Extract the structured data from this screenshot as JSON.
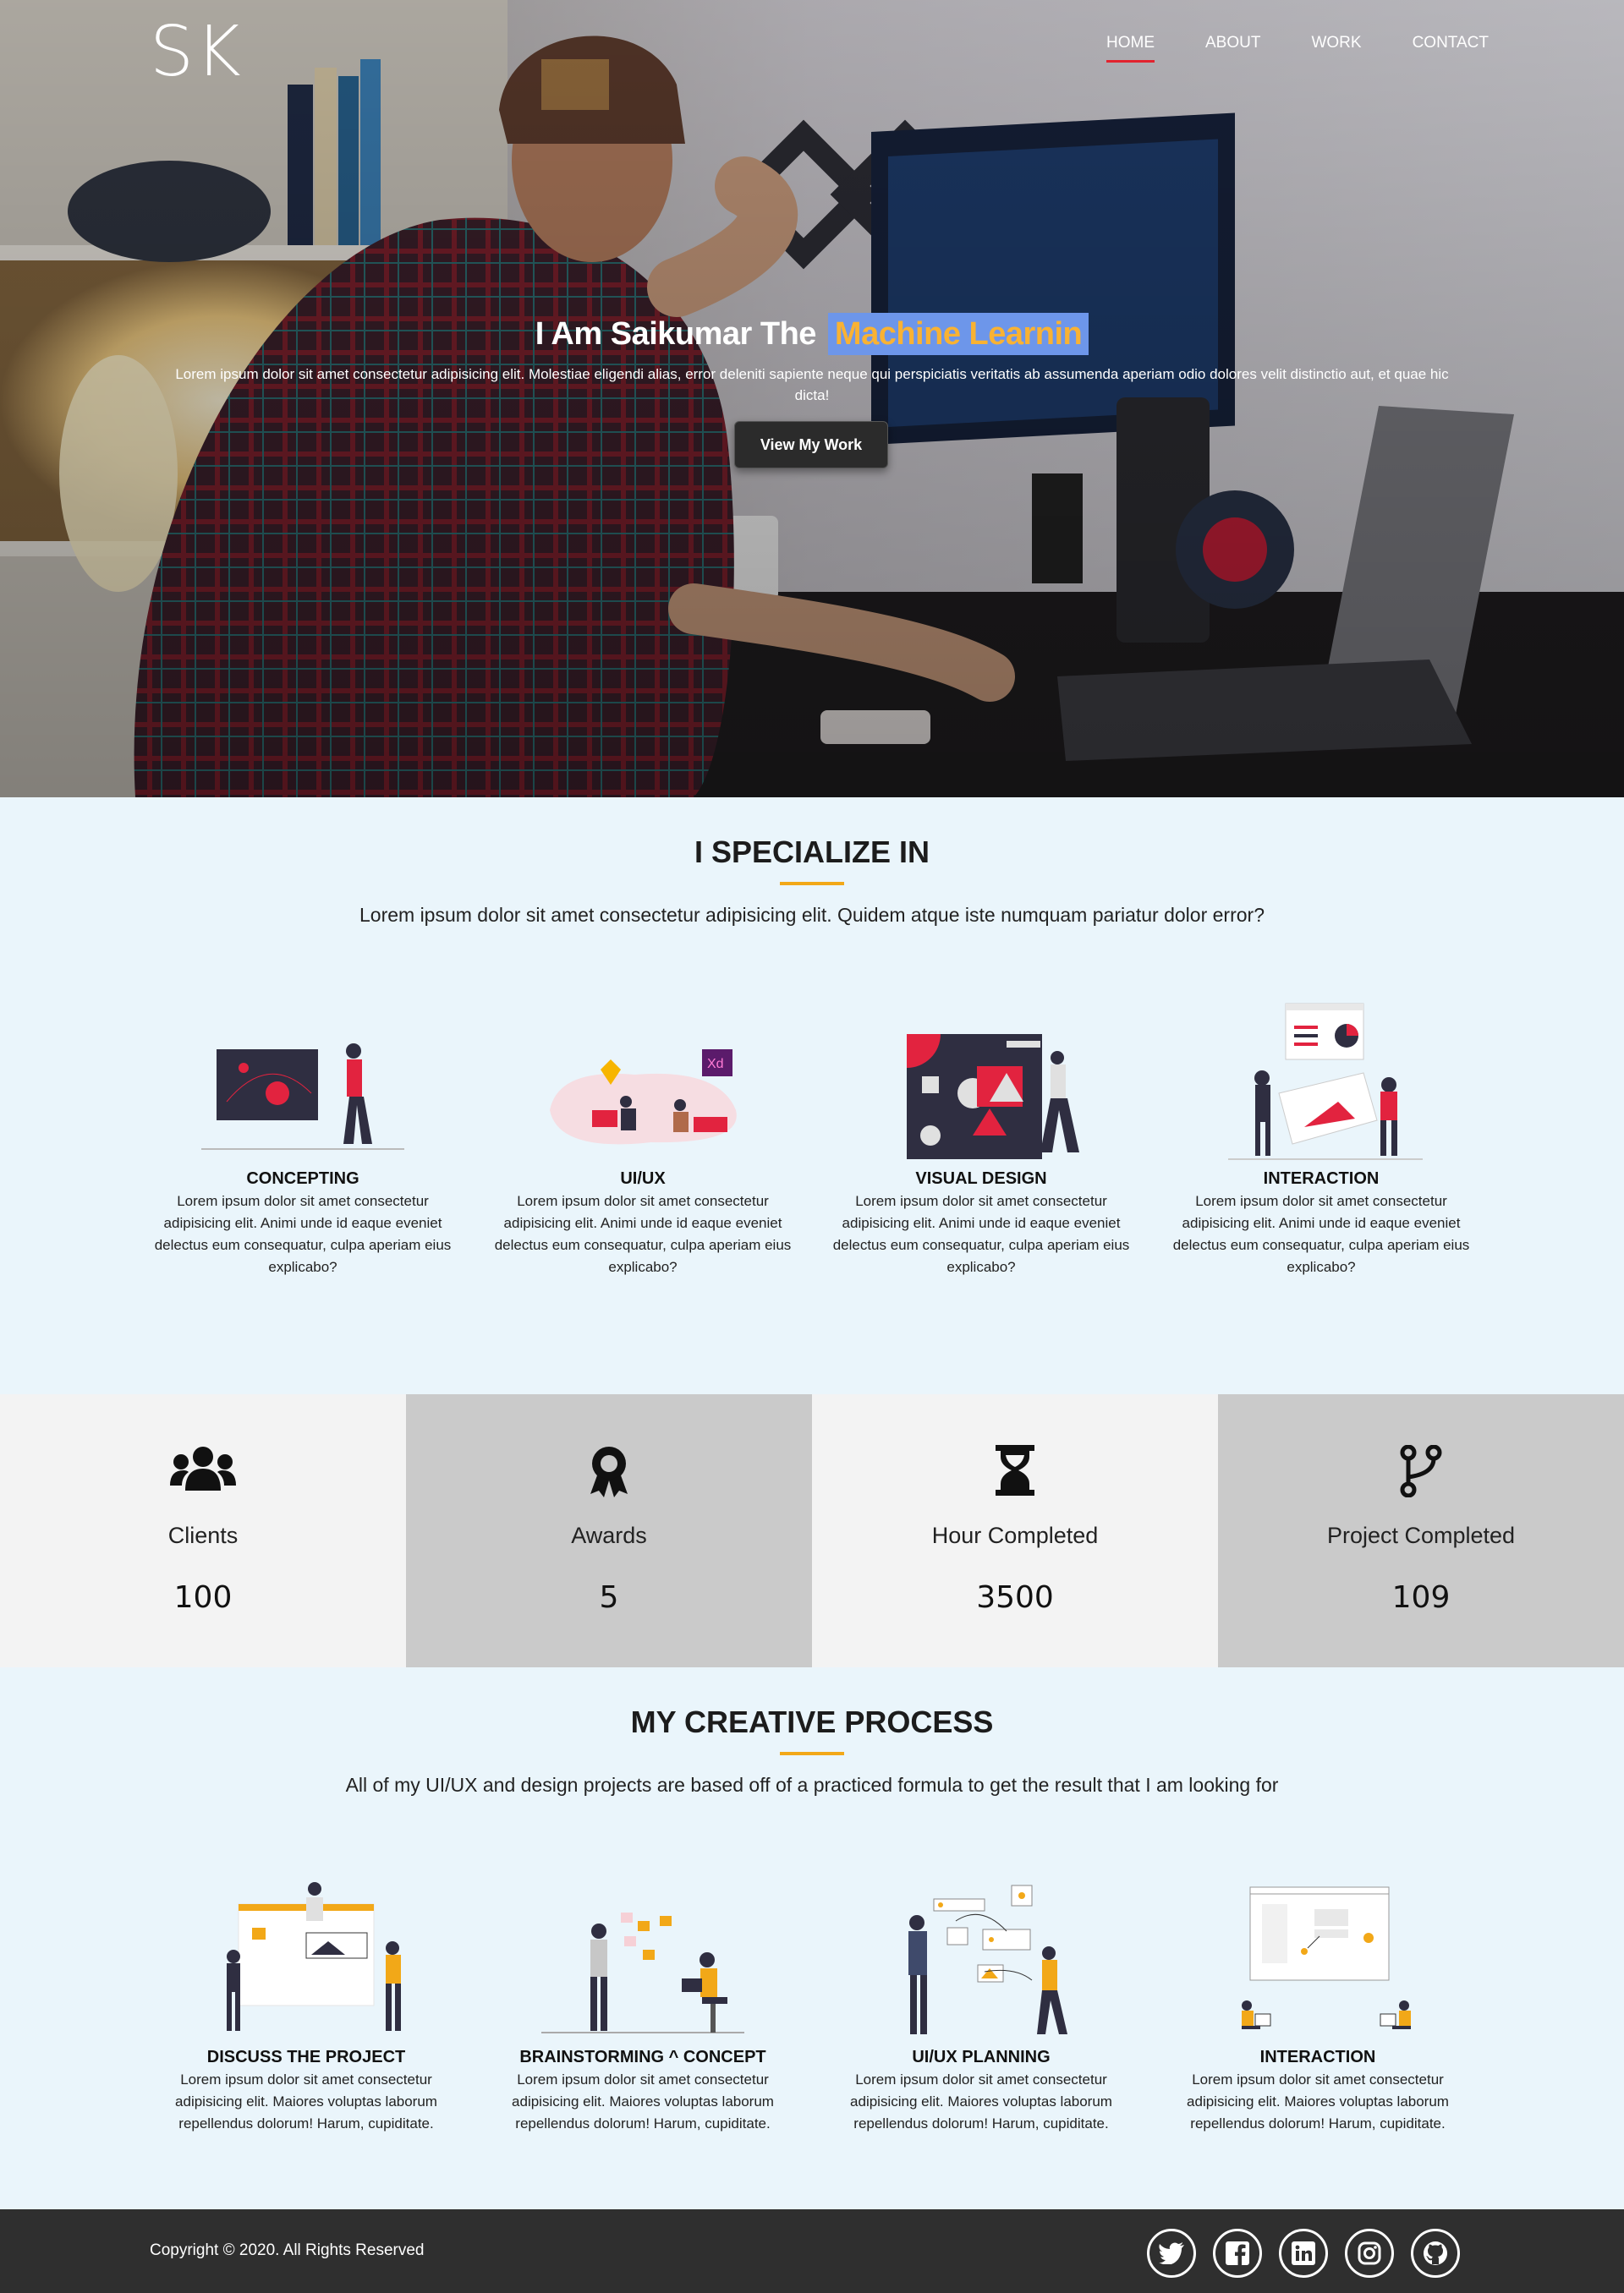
{
  "header": {
    "logo": "SK",
    "nav": [
      "HOME",
      "ABOUT",
      "WORK",
      "CONTACT"
    ],
    "active_nav": "HOME"
  },
  "hero": {
    "title_prefix": "I Am Saikumar The",
    "title_highlight": "Machine Learnin",
    "subtitle": "Lorem ipsum dolor sit amet consectetur adipisicing elit. Molestiae eligendi alias, error deleniti sapiente neque qui perspiciatis veritatis ab assumenda aperiam odio dolores velit distinctio aut, et quae hic dicta!",
    "button": "View My Work",
    "colors": {
      "highlight_bg": "#6d96ea",
      "highlight_text": "#f9b233",
      "nav_active": "#e2232f"
    }
  },
  "specialize": {
    "title": "I SPECIALIZE IN",
    "subtitle": "Lorem ipsum dolor sit amet consectetur adipisicing elit. Quidem atque iste numquam pariatur dolor error?",
    "cards": [
      {
        "title": "CONCEPTING",
        "text": "Lorem ipsum dolor sit amet consectetur adipisicing elit. Animi unde id eaque eveniet delectus eum consequatur, culpa aperiam eius explicabo?"
      },
      {
        "title": "UI/UX",
        "text": "Lorem ipsum dolor sit amet consectetur adipisicing elit. Animi unde id eaque eveniet delectus eum consequatur, culpa aperiam eius explicabo?"
      },
      {
        "title": "VISUAL DESIGN",
        "text": "Lorem ipsum dolor sit amet consectetur adipisicing elit. Animi unde id eaque eveniet delectus eum consequatur, culpa aperiam eius explicabo?"
      },
      {
        "title": "INTERACTION",
        "text": "Lorem ipsum dolor sit amet consectetur adipisicing elit. Animi unde id eaque eveniet delectus eum consequatur, culpa aperiam eius explicabo?"
      }
    ]
  },
  "stats": [
    {
      "label": "Clients",
      "value": "100",
      "icon": "users-icon"
    },
    {
      "label": "Awards",
      "value": "5",
      "icon": "award-icon"
    },
    {
      "label": "Hour Completed",
      "value": "3500",
      "icon": "hourglass-icon"
    },
    {
      "label": "Project Completed",
      "value": "109",
      "icon": "code-branch-icon"
    }
  ],
  "process": {
    "title": "MY CREATIVE PROCESS",
    "subtitle": "All of my UI/UX and design projects are based off of a practiced formula to get the result that I am looking for",
    "cards": [
      {
        "title": "DISCUSS THE PROJECT",
        "text": "Lorem ipsum dolor sit amet consectetur adipisicing elit. Maiores voluptas laborum repellendus dolorum! Harum, cupiditate."
      },
      {
        "title": "BRAINSTORMING ^ CONCEPT",
        "text": "Lorem ipsum dolor sit amet consectetur adipisicing elit. Maiores voluptas laborum repellendus dolorum! Harum, cupiditate."
      },
      {
        "title": "UI/UX PLANNING",
        "text": "Lorem ipsum dolor sit amet consectetur adipisicing elit. Maiores voluptas laborum repellendus dolorum! Harum, cupiditate."
      },
      {
        "title": "INTERACTION",
        "text": "Lorem ipsum dolor sit amet consectetur adipisicing elit. Maiores voluptas laborum repellendus dolorum! Harum, cupiditate."
      }
    ]
  },
  "footer": {
    "copyright": "Copyright © 2020. All Rights Reserved",
    "social": [
      "twitter-icon",
      "facebook-icon",
      "linkedin-icon",
      "instagram-icon",
      "github-icon"
    ]
  },
  "accent_color": "#f2a818"
}
